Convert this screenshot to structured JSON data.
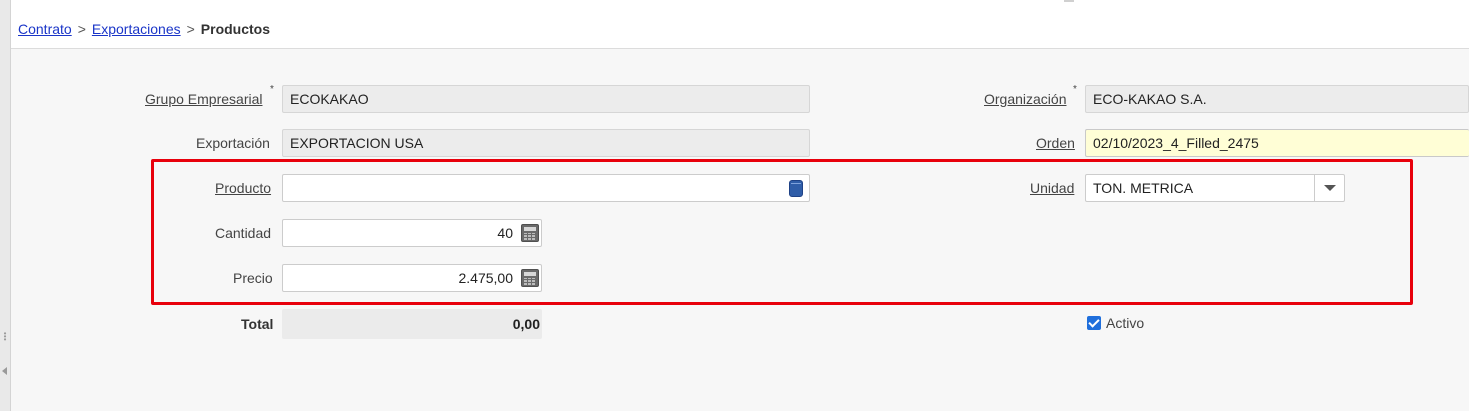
{
  "breadcrumb": {
    "items": [
      "Contrato",
      "Exportaciones"
    ],
    "separator": ">",
    "current": "Productos"
  },
  "form": {
    "grupo_empresarial": {
      "label": "Grupo Empresarial",
      "required_mark": "*",
      "value": "ECOKAKAO"
    },
    "organizacion": {
      "label": "Organización",
      "required_mark": "*",
      "value": "ECO-KAKAO S.A."
    },
    "exportacion": {
      "label": "Exportación",
      "value": "EXPORTACION USA"
    },
    "orden": {
      "label": "Orden",
      "value": "02/10/2023_4_Filled_2475"
    },
    "producto": {
      "label": "Producto",
      "value": "",
      "icon": "database-icon"
    },
    "unidad": {
      "label": "Unidad",
      "value": "TON. METRICA",
      "icon": "chevron-down-icon"
    },
    "cantidad": {
      "label": "Cantidad",
      "value": "40",
      "icon": "calculator-icon"
    },
    "precio": {
      "label": "Precio",
      "value": "2.475,00",
      "icon": "calculator-icon"
    },
    "total": {
      "label": "Total",
      "value": "0,00"
    },
    "activo": {
      "label": "Activo",
      "checked": true
    }
  },
  "colors": {
    "highlight": "#e8000c",
    "link": "#1a35c8",
    "checkbox": "#1f6fdc",
    "focused_field": "#fffed6"
  }
}
